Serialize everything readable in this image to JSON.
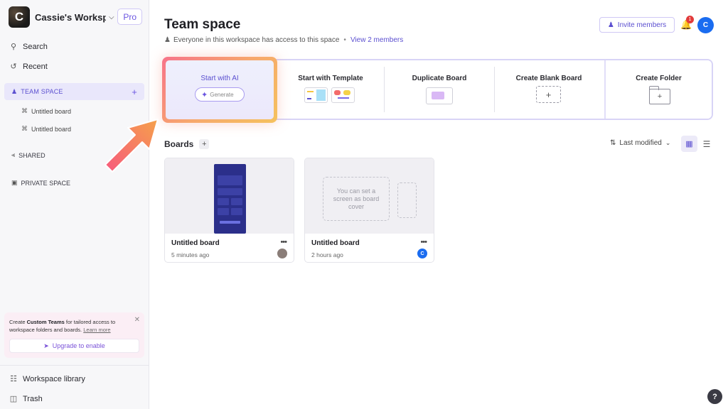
{
  "sidebar": {
    "workspace_initial": "C",
    "workspace_name": "Cassie's Worksp...",
    "plan_badge": "Pro",
    "search_label": "Search",
    "recent_label": "Recent",
    "team_space_label": "TEAM SPACE",
    "team_items": [
      {
        "label": "Untitled board"
      },
      {
        "label": "Untitled board"
      }
    ],
    "shared_label": "SHARED",
    "private_label": "PRIVATE SPACE",
    "promo": {
      "text_pre": "Create ",
      "text_bold": "Custom Teams",
      "text_post": " for tailored access to workspace folders and boards. ",
      "link": "Learn more",
      "button": "Upgrade to enable"
    },
    "library_label": "Workspace library",
    "trash_label": "Trash"
  },
  "header": {
    "title": "Team space",
    "access_text": "Everyone in this workspace has access to this space",
    "members_link": "View 2 members",
    "invite_label": "Invite members",
    "notification_count": "1",
    "user_initial": "C"
  },
  "actions": {
    "ai_title": "Start with AI",
    "generate_placeholder": "Generate",
    "template": "Start with Template",
    "duplicate": "Duplicate Board",
    "blank": "Create Blank Board",
    "folder": "Create Folder"
  },
  "boards": {
    "title": "Boards",
    "sort_label": "Last modified",
    "cover_hint": "You can set a screen as board cover",
    "items": [
      {
        "name": "Untitled board",
        "time": "5 minutes ago",
        "owner": ""
      },
      {
        "name": "Untitled board",
        "time": "2 hours ago",
        "owner": "C"
      }
    ]
  },
  "colors": {
    "accent": "#5b4fd0",
    "avatar_blue": "#1a6cf0",
    "notification_red": "#e23b3b"
  }
}
